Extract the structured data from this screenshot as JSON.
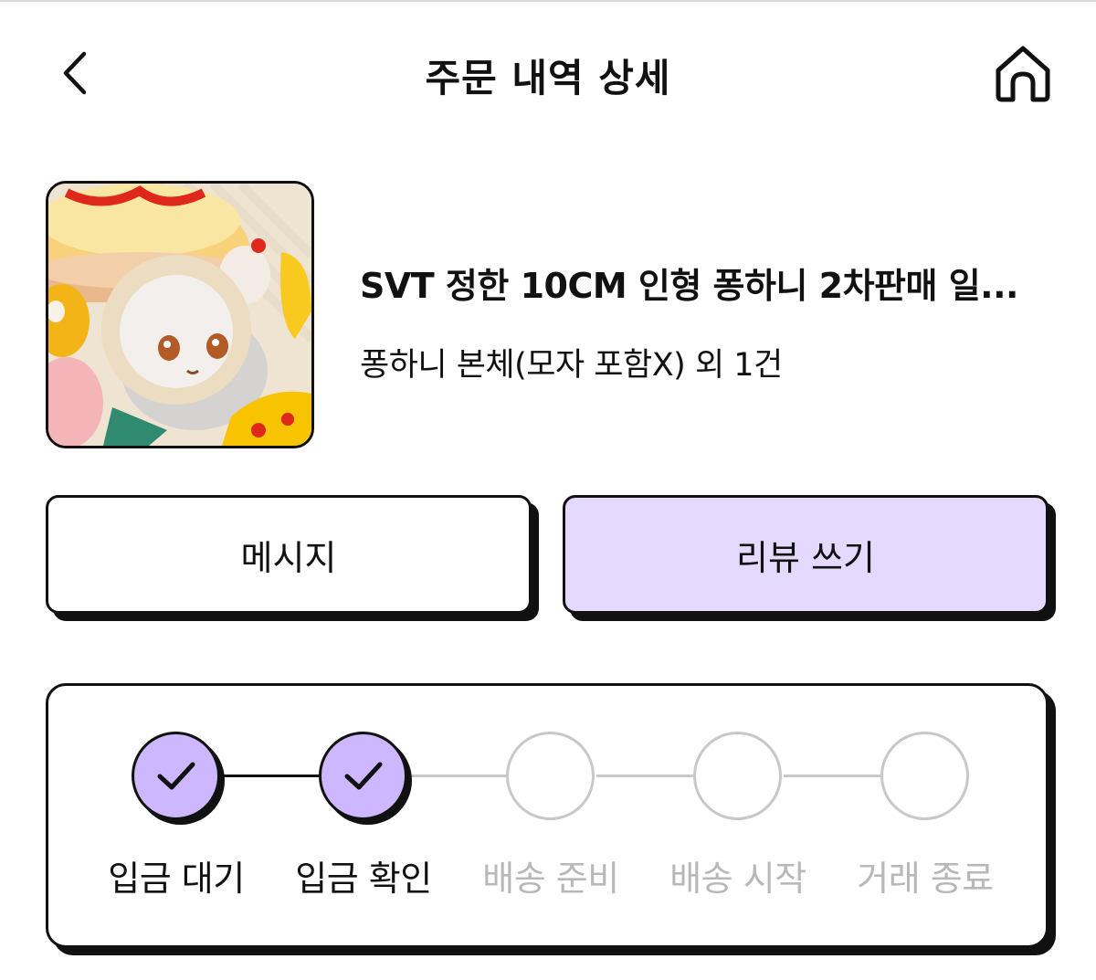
{
  "header": {
    "title": "주문 내역 상세"
  },
  "product": {
    "name": "SVT 정한 10CM 인형 퐁하니 2차판매 일...",
    "option": "퐁하니 본체(모자 포함X) 외 1건"
  },
  "actions": {
    "message_label": "메시지",
    "review_label": "리뷰 쓰기"
  },
  "progress": {
    "steps": [
      {
        "label": "입금 대기",
        "done": true
      },
      {
        "label": "입금 확인",
        "done": true
      },
      {
        "label": "배송 준비",
        "done": false
      },
      {
        "label": "배송 시작",
        "done": false
      },
      {
        "label": "거래 종료",
        "done": false
      }
    ]
  },
  "colors": {
    "accent": "#cdb8ff",
    "review_button_bg": "#e5d9ff",
    "inactive": "#c8c8c8",
    "inactive_text": "#b8b8b8",
    "ink": "#111111"
  },
  "icons": {
    "back": "chevron-left-icon",
    "home": "home-icon",
    "step_done": "check-icon"
  }
}
